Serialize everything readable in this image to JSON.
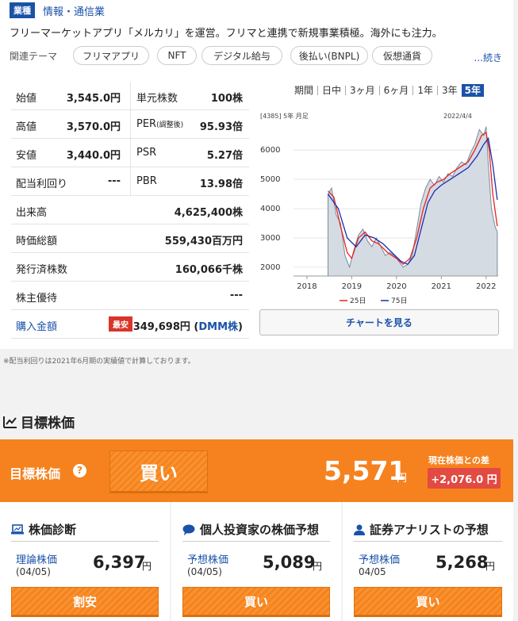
{
  "header": {
    "badge": "業種",
    "sector": "情報・通信業",
    "description": "フリーマーケットアプリ「メルカリ」を運営。フリマと連携で新規事業積極。海外にも注力。"
  },
  "themes": {
    "label": "関連テーマ",
    "chips": [
      "フリマアプリ",
      "NFT",
      "デジタル給与",
      "後払い(BNPL)",
      "仮想通貨"
    ],
    "more": "...続き"
  },
  "stats": {
    "open_label": "始値",
    "open": "3,545.0円",
    "unit_label": "単元株数",
    "unit": "100株",
    "high_label": "高値",
    "high": "3,570.0円",
    "per_label": "PER",
    "per_small": "(調整後)",
    "per": "95.93倍",
    "low_label": "安値",
    "low": "3,440.0円",
    "psr_label": "PSR",
    "psr": "5.27倍",
    "yield_label": "配当利回り",
    "yield": "---",
    "pbr_label": "PBR",
    "pbr": "13.98倍",
    "volume_label": "出来高",
    "volume": "4,625,400株",
    "mcap_label": "時価総額",
    "mcap": "559,430百万円",
    "shares_label": "発行済株数",
    "shares": "160,066千株",
    "benefit_label": "株主優待",
    "benefit": "---",
    "buy_label": "購入金額",
    "cheapest": "最安",
    "buy_amount": "349,698円 (",
    "broker": "DMM株",
    "buy_close": ")"
  },
  "chart_controls": {
    "periods": [
      "期間",
      "日中",
      "3ヶ月",
      "6ヶ月",
      "1年",
      "3年"
    ],
    "selected": "5年",
    "button": "チャートを見る"
  },
  "chart_data": {
    "type": "line",
    "code_label": "[4385] 5年 月足",
    "date_label": "2022/4/4",
    "x_ticks": [
      "2018",
      "2019",
      "2020",
      "2021",
      "2022"
    ],
    "y_ticks": [
      2000,
      3000,
      4000,
      5000,
      6000
    ],
    "ylim": [
      1700,
      6900
    ],
    "xlim": [
      2017.7,
      2022.27
    ],
    "series": [
      {
        "name": "25日",
        "color": "#e8231c"
      },
      {
        "name": "75日",
        "color": "#1a2fb0"
      }
    ],
    "price": [
      [
        2018.47,
        4500
      ],
      [
        2018.55,
        4700
      ],
      [
        2018.65,
        3800
      ],
      [
        2018.75,
        3500
      ],
      [
        2018.85,
        2400
      ],
      [
        2018.95,
        2000
      ],
      [
        2019.05,
        2600
      ],
      [
        2019.15,
        3100
      ],
      [
        2019.25,
        3300
      ],
      [
        2019.35,
        2900
      ],
      [
        2019.45,
        2700
      ],
      [
        2019.55,
        3000
      ],
      [
        2019.65,
        2700
      ],
      [
        2019.75,
        2400
      ],
      [
        2019.85,
        2500
      ],
      [
        2019.95,
        2400
      ],
      [
        2020.05,
        2200
      ],
      [
        2020.15,
        2000
      ],
      [
        2020.25,
        2100
      ],
      [
        2020.35,
        2400
      ],
      [
        2020.45,
        3300
      ],
      [
        2020.55,
        4200
      ],
      [
        2020.65,
        4700
      ],
      [
        2020.75,
        5000
      ],
      [
        2020.85,
        4800
      ],
      [
        2020.95,
        5100
      ],
      [
        2021.05,
        4900
      ],
      [
        2021.15,
        5200
      ],
      [
        2021.25,
        5100
      ],
      [
        2021.35,
        5400
      ],
      [
        2021.45,
        5600
      ],
      [
        2021.55,
        5500
      ],
      [
        2021.65,
        5900
      ],
      [
        2021.75,
        6200
      ],
      [
        2021.85,
        6700
      ],
      [
        2021.95,
        6500
      ],
      [
        2022.0,
        6800
      ],
      [
        2022.05,
        5500
      ],
      [
        2022.12,
        4000
      ],
      [
        2022.2,
        3400
      ],
      [
        2022.25,
        3200
      ]
    ],
    "ma25": [
      [
        2018.47,
        4600
      ],
      [
        2018.6,
        4400
      ],
      [
        2018.75,
        3400
      ],
      [
        2018.9,
        2500
      ],
      [
        2019.0,
        2300
      ],
      [
        2019.15,
        3000
      ],
      [
        2019.3,
        3200
      ],
      [
        2019.45,
        2900
      ],
      [
        2019.6,
        2800
      ],
      [
        2019.8,
        2500
      ],
      [
        2020.0,
        2300
      ],
      [
        2020.15,
        2100
      ],
      [
        2020.3,
        2300
      ],
      [
        2020.45,
        3000
      ],
      [
        2020.6,
        4000
      ],
      [
        2020.75,
        4700
      ],
      [
        2020.9,
        4900
      ],
      [
        2021.05,
        5000
      ],
      [
        2021.2,
        5200
      ],
      [
        2021.4,
        5400
      ],
      [
        2021.6,
        5600
      ],
      [
        2021.75,
        6000
      ],
      [
        2021.9,
        6500
      ],
      [
        2022.0,
        6600
      ],
      [
        2022.07,
        6000
      ],
      [
        2022.15,
        4500
      ],
      [
        2022.25,
        3400
      ]
    ],
    "ma75": [
      [
        2018.47,
        4500
      ],
      [
        2018.7,
        4000
      ],
      [
        2018.9,
        3000
      ],
      [
        2019.1,
        2700
      ],
      [
        2019.3,
        3100
      ],
      [
        2019.5,
        3000
      ],
      [
        2019.7,
        2800
      ],
      [
        2019.9,
        2500
      ],
      [
        2020.1,
        2200
      ],
      [
        2020.25,
        2100
      ],
      [
        2020.4,
        2400
      ],
      [
        2020.55,
        3300
      ],
      [
        2020.7,
        4200
      ],
      [
        2020.85,
        4600
      ],
      [
        2021.0,
        4800
      ],
      [
        2021.2,
        5000
      ],
      [
        2021.4,
        5200
      ],
      [
        2021.6,
        5400
      ],
      [
        2021.8,
        5800
      ],
      [
        2021.95,
        6200
      ],
      [
        2022.05,
        6400
      ],
      [
        2022.15,
        5500
      ],
      [
        2022.25,
        4300
      ]
    ]
  },
  "note": "※配当利回りは2021年6月期の実績値で計算しております。",
  "target": {
    "section_title": "目標株価",
    "label": "目標株価",
    "help": "?",
    "rating": "買い",
    "price": "5,571",
    "yen": "円",
    "diff_label": "現在株価との差",
    "diff": "+2,076.0 円"
  },
  "columns": [
    {
      "title": "株価診断",
      "sub": "理論株価",
      "date": "(04/05)",
      "price": "6,397",
      "yen": "円",
      "button": "割安"
    },
    {
      "title": "個人投資家の株価予想",
      "sub": "予想株価",
      "date": "(04/05)",
      "price": "5,089",
      "yen": "円",
      "button": "買い"
    },
    {
      "title": "証券アナリストの予想",
      "sub": "予想株価",
      "date": "04/05",
      "price": "5,268",
      "yen": "円",
      "button": "買い"
    }
  ]
}
